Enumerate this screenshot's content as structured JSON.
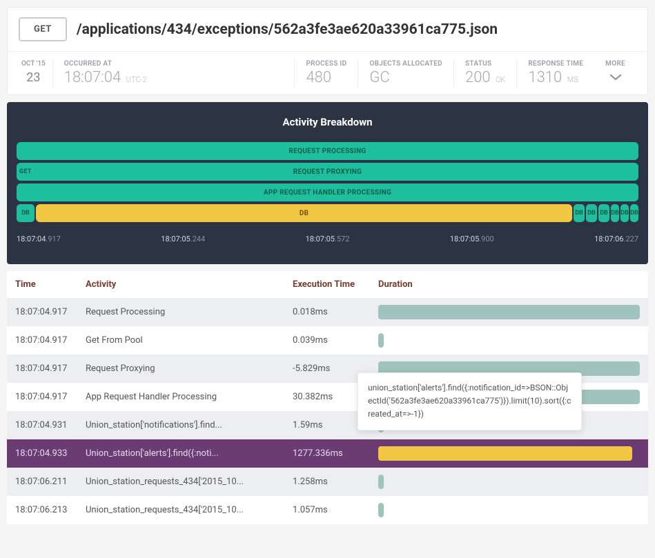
{
  "request": {
    "method": "GET",
    "path": "/applications/434/exceptions/562a3fe3ae620a33961ca775.json"
  },
  "meta": {
    "date_month": "OCT '15",
    "date_day": "23",
    "occurred_label": "OCCURRED AT",
    "occurred_time": "18:07:04",
    "occurred_tz": "UTC-2",
    "process_label": "PROCESS ID",
    "process_value": "480",
    "objects_label": "OBJECTS ALLOCATED",
    "objects_value": "GC",
    "status_label": "STATUS",
    "status_value": "200",
    "status_suffix": "OK",
    "response_label": "RESPONSE TIME",
    "response_value": "1310",
    "response_suffix": "MS",
    "more_label": "MORE"
  },
  "breakdown": {
    "title": "Activity Breakdown",
    "bars": {
      "request_processing": "REQUEST PROCESSING",
      "get_label": "GET",
      "request_proxying": "REQUEST PROXYING",
      "app_handler": "APP REQUEST HANDLER PROCESSING",
      "db_small": "DB",
      "db_main": "DB"
    },
    "ticks": [
      {
        "main": "18:07:04",
        "frac": ".917"
      },
      {
        "main": "18:07:05",
        "frac": ".244"
      },
      {
        "main": "18:07:05",
        "frac": ".572"
      },
      {
        "main": "18:07:05",
        "frac": ".900"
      },
      {
        "main": "18:07:06",
        "frac": ".227"
      }
    ]
  },
  "table": {
    "headers": {
      "time": "Time",
      "activity": "Activity",
      "exec": "Execution Time",
      "duration": "Duration"
    },
    "rows": [
      {
        "time": "18:07:04.917",
        "activity": "Request Processing",
        "exec": "0.018ms",
        "bar_pct": 100,
        "color": "teal",
        "highlight": false
      },
      {
        "time": "18:07:04.917",
        "activity": "Get From Pool",
        "exec": "0.039ms",
        "bar_pct": 2,
        "color": "teal",
        "highlight": false
      },
      {
        "time": "18:07:04.917",
        "activity": "Request Proxying",
        "exec": "-5.829ms",
        "bar_pct": 100,
        "color": "teal",
        "highlight": false
      },
      {
        "time": "18:07:04.917",
        "activity": "App Request Handler Processing",
        "exec": "30.382ms",
        "bar_pct": 100,
        "color": "teal",
        "highlight": false
      },
      {
        "time": "18:07:04.931",
        "activity": "Union_station['notifications'].find...",
        "exec": "1.59ms",
        "bar_pct": 2,
        "color": "teal",
        "highlight": false
      },
      {
        "time": "18:07:04.933",
        "activity": "Union_station['alerts'].find({:noti...",
        "exec": "1277.336ms",
        "bar_pct": 97,
        "color": "yellow",
        "highlight": true
      },
      {
        "time": "18:07:06.211",
        "activity": "Union_station_requests_434['2015_10...",
        "exec": "1.258ms",
        "bar_pct": 2,
        "color": "teal",
        "highlight": false
      },
      {
        "time": "18:07:06.213",
        "activity": "Union_station_requests_434['2015_10...",
        "exec": "1.057ms",
        "bar_pct": 2,
        "color": "teal",
        "highlight": false
      }
    ]
  },
  "tooltip": {
    "text": "union_station['alerts'].find({:notification_id=>BSON::ObjectId('562a3fe3ae620a33961ca775')}).limit(10).sort({:created_at=>-1})"
  }
}
